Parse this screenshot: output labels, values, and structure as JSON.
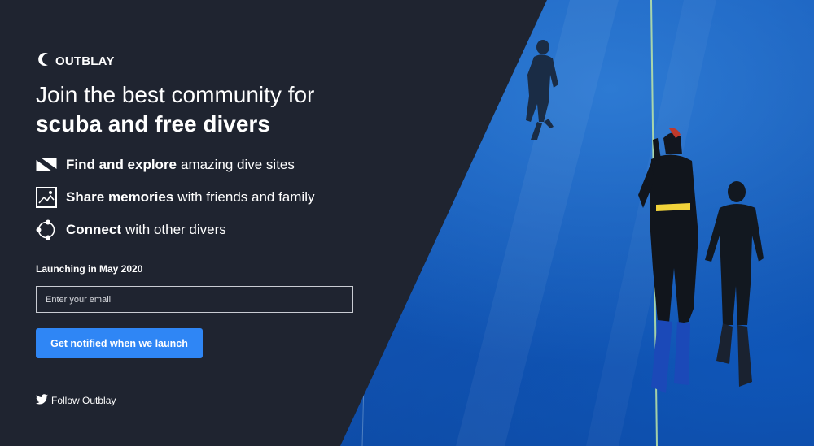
{
  "brand": {
    "name": "OUTBLAY",
    "logo_icon": "crescent-wave-icon"
  },
  "hero": {
    "line1": "Join the best community for",
    "line2": "scuba and free divers"
  },
  "features": [
    {
      "icon": "dive-flag-icon",
      "bold": "Find and explore",
      "rest": "amazing dive sites"
    },
    {
      "icon": "photo-icon",
      "bold": "Share memories",
      "rest": "with friends and family"
    },
    {
      "icon": "network-icon",
      "bold": "Connect",
      "rest": "with other divers"
    }
  ],
  "signup": {
    "launch_text": "Launching in May 2020",
    "email_placeholder": "Enter your email",
    "button_label": "Get notified when we launch"
  },
  "social": {
    "icon": "twitter-icon",
    "label": "Follow Outblay"
  },
  "colors": {
    "panel_bg": "#1f2430",
    "accent": "#2f86f5",
    "ocean": "#1458b8"
  }
}
